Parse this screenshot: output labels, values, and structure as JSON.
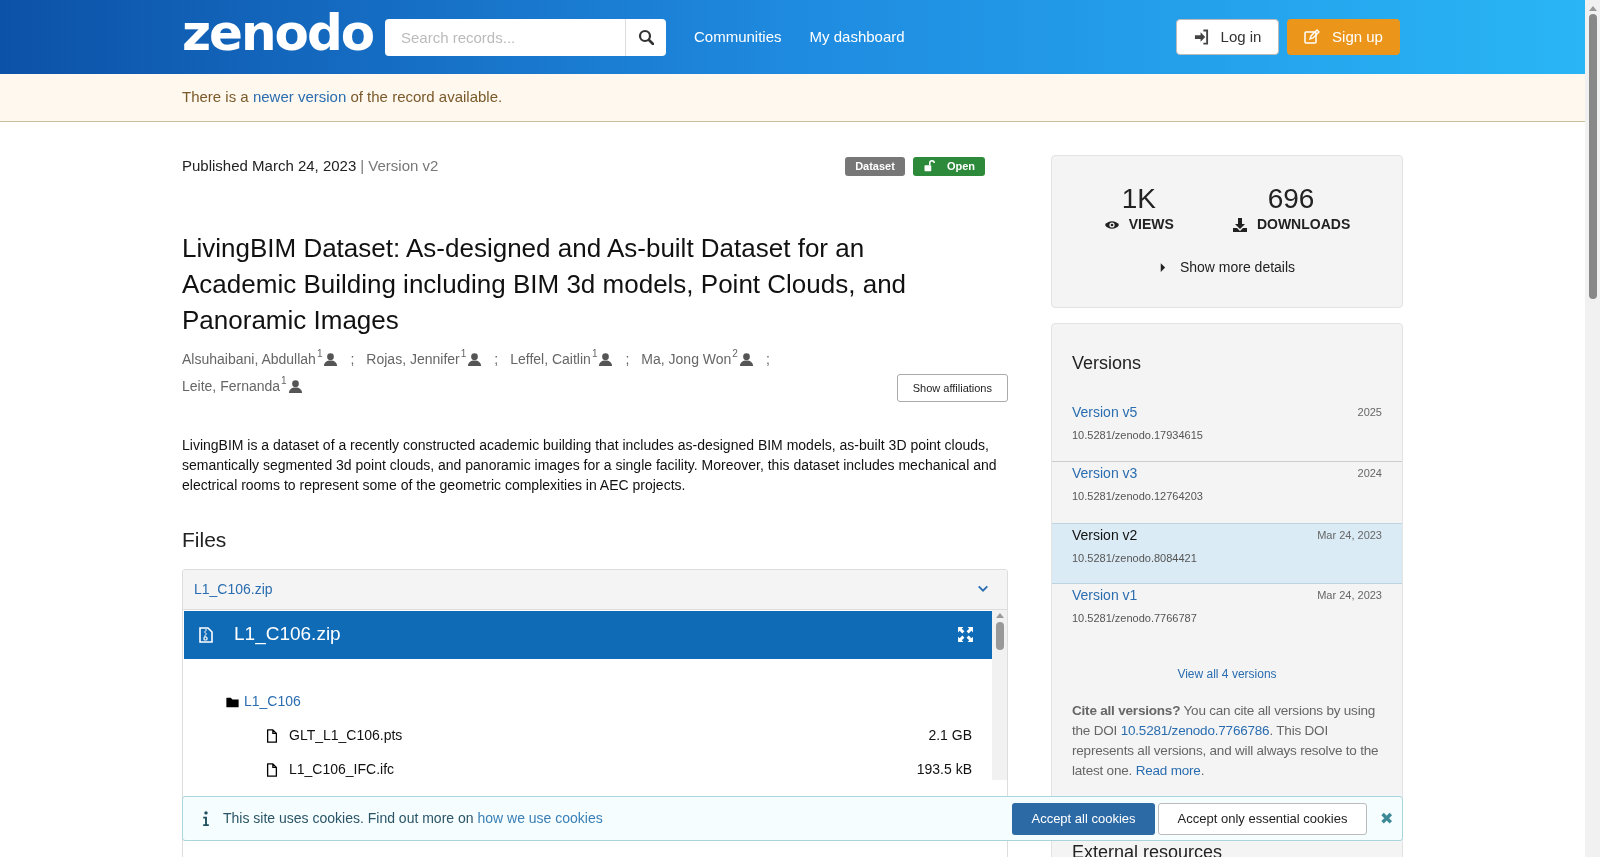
{
  "header": {
    "logo": "zenodo",
    "search": {
      "placeholder": "Search records..."
    },
    "nav": [
      "Communities",
      "My dashboard"
    ],
    "buttons": [
      {
        "label": "Log in",
        "kind": "login"
      },
      {
        "label": "Sign up",
        "kind": "signup"
      }
    ]
  },
  "notice": {
    "before": "There is a",
    "link": "newer version",
    "after": "of the record available."
  },
  "record": {
    "published": "Published March 24, 2023",
    "version": "| Version v2",
    "badges": [
      {
        "label": "Dataset",
        "kind": "type"
      },
      {
        "label": "Open",
        "kind": "access"
      }
    ],
    "title": "LivingBIM Dataset: As-designed and As-built Dataset for an Academic Building including BIM 3d models, Point Clouds, and Panoramic Images",
    "creators": [
      {
        "name": "Alsuhaibani, Abdullah",
        "affiliation": "1",
        "separator": ";"
      },
      {
        "name": "Rojas, Jennifer",
        "affiliation": "1",
        "separator": ";"
      },
      {
        "name": "Leffel, Caitlin",
        "affiliation": "1",
        "separator": ";"
      },
      {
        "name": "Ma, Jong Won",
        "affiliation": "2",
        "separator": ";"
      },
      {
        "name": "Leite, Fernanda",
        "affiliation": "1"
      }
    ],
    "show_affiliations": "Show affiliations",
    "description": "LivingBIM is a dataset of a recently constructed academic building that includes as-designed BIM models, as-built 3D point clouds, semantically segmented 3d point clouds, and panoramic images for a single facility. Moreover, this dataset includes mechanical and electrical rooms to represent some of the geometric complexities in AEC projects."
  },
  "files": {
    "heading": "Files",
    "accordion_label": "L1_C106.zip",
    "expanded": true,
    "preview_title": "L1_C106.zip",
    "tree": [
      {
        "name": "L1_C106",
        "kind": "folder",
        "children": [
          {
            "name": "GLT_L1_C106.pts",
            "kind": "file",
            "size": "2.1 GB"
          },
          {
            "name": "L1_C106_IFC.ifc",
            "kind": "file",
            "size": "193.5 kB"
          }
        ]
      }
    ]
  },
  "stats": {
    "items": [
      {
        "value": "1K",
        "label": "VIEWS",
        "kind": "views"
      },
      {
        "value": "696",
        "label": "DOWNLOADS",
        "kind": "downloads"
      }
    ],
    "show_more": "Show more details"
  },
  "versions": {
    "heading": "Versions",
    "items": [
      {
        "label": "Version v5",
        "date": "2025",
        "doi": "10.5281/zenodo.17934615",
        "selected": false
      },
      {
        "label": "Version v3",
        "date": "2024",
        "doi": "10.5281/zenodo.12764203",
        "selected": false
      },
      {
        "label": "Version v2",
        "date": "Mar 24, 2023",
        "doi": "10.5281/zenodo.8084421",
        "selected": true
      },
      {
        "label": "Version v1",
        "date": "Mar 24, 2023",
        "doi": "10.5281/zenodo.7766787",
        "selected": false
      }
    ],
    "view_all": "View all 4 versions",
    "cite": {
      "lead": "**Cite all versions?** You can cite all versions by using the DOI",
      "doi": "10.5281/zenodo.7766786",
      "middle": ". This DOI represents all versions, and will always resolve to the latest one.",
      "read_more": "Read more",
      "end": "."
    }
  },
  "external": {
    "heading": "External resources"
  },
  "cookie_banner": {
    "text": "This site uses cookies. Find out more on",
    "link": "how we use cookies",
    "buttons": [
      {
        "label": "Accept all cookies",
        "kind": "primary"
      },
      {
        "label": "Accept only essential cookies",
        "kind": "secondary"
      }
    ],
    "close": "✖"
  }
}
